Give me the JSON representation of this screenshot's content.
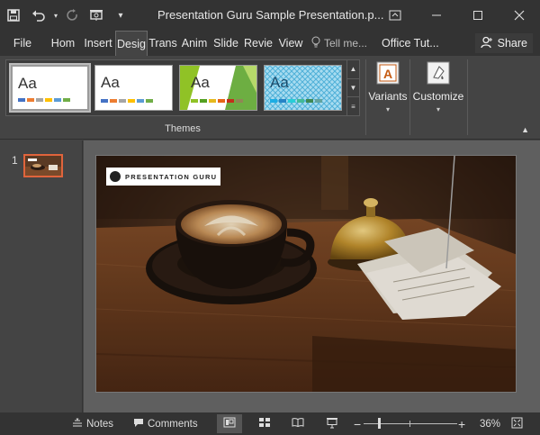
{
  "window": {
    "title": "Presentation Guru Sample Presentation.p...",
    "quick_access": [
      "save-icon",
      "undo-icon",
      "redo-icon",
      "present-icon",
      "customize-qat-icon"
    ]
  },
  "tabs": [
    {
      "label": "File",
      "active": false
    },
    {
      "label": "Hom",
      "active": false
    },
    {
      "label": "Insert",
      "active": false
    },
    {
      "label": "Desig",
      "active": true
    },
    {
      "label": "Trans",
      "active": false
    },
    {
      "label": "Anim",
      "active": false
    },
    {
      "label": "Slide",
      "active": false
    },
    {
      "label": "Revie",
      "active": false
    },
    {
      "label": "View",
      "active": false
    }
  ],
  "tell_me": "Tell me...",
  "office_tut": "Office Tut...",
  "share": "Share",
  "ribbon": {
    "themes_group_label": "Themes",
    "theme_thumb_text": "Aa",
    "themes": [
      {
        "name": "office-theme",
        "colors": [
          "#4472c4",
          "#ed7d31",
          "#a5a5a5",
          "#ffc000",
          "#5b9bd5",
          "#70ad47"
        ]
      },
      {
        "name": "office-theme-2",
        "colors": [
          "#4472c4",
          "#ed7d31",
          "#a5a5a5",
          "#ffc000",
          "#5b9bd5",
          "#70ad47"
        ]
      },
      {
        "name": "facet-theme",
        "colors": [
          "#90c226",
          "#54a021",
          "#e6b91e",
          "#e76618",
          "#c42f1a",
          "#918655"
        ]
      },
      {
        "name": "pattern-theme",
        "colors": [
          "#1cade4",
          "#2683c6",
          "#27ced7",
          "#42ba97",
          "#3e8853",
          "#62a39f"
        ]
      }
    ],
    "variants_label": "Variants",
    "customize_label": "Customize"
  },
  "slides": [
    {
      "number": "1"
    }
  ],
  "slide_content": {
    "logo_text": "PRESENTATION GURU"
  },
  "statusbar": {
    "notes_label": "Notes",
    "comments_label": "Comments",
    "zoom_minus": "−",
    "zoom_plus": "+",
    "zoom": "36%"
  }
}
